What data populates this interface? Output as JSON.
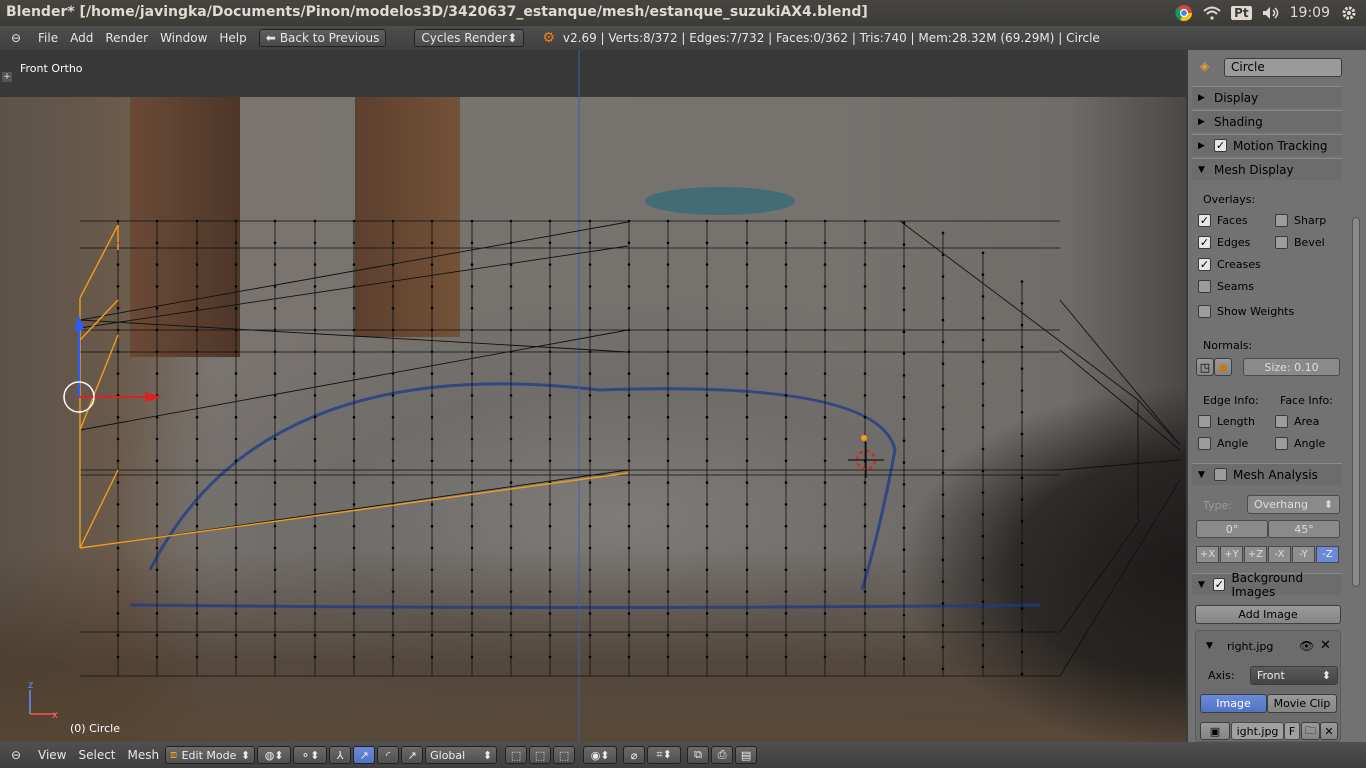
{
  "window": {
    "title": "Blender* [/home/javingka/Documents/Pinon/modelos3D/3420637_estanque/mesh/estanque_suzukiAX4.blend]"
  },
  "tray": {
    "input_method": "Pt",
    "time": "19:09"
  },
  "menu": {
    "file": "File",
    "add": "Add",
    "render": "Render",
    "window": "Window",
    "help": "Help",
    "back": "Back to Previous",
    "engine": "Cycles Render"
  },
  "stats": "v2.69 | Verts:8/372 | Edges:7/732 | Faces:0/362 | Tris:740 | Mem:28.32M (69.29M) | Circle",
  "viewport": {
    "view_name": "Front Ortho",
    "object_label": "(0) Circle",
    "axis_z": "z",
    "axis_x": "x"
  },
  "props": {
    "object_name": "Circle",
    "panels": {
      "display": "Display",
      "shading": "Shading",
      "motion_tracking": "Motion Tracking",
      "mesh_display": "Mesh Display",
      "mesh_analysis": "Mesh Analysis",
      "background_images": "Background Images"
    },
    "overlays_label": "Overlays:",
    "overlays": {
      "faces": "Faces",
      "sharp": "Sharp",
      "edges": "Edges",
      "bevel": "Bevel",
      "creases": "Creases",
      "seams": "Seams",
      "show_weights": "Show Weights"
    },
    "normals_label": "Normals:",
    "normals_size": "Size: 0.10",
    "edge_info_label": "Edge Info:",
    "face_info_label": "Face Info:",
    "edge_info": {
      "length": "Length",
      "angle": "Angle"
    },
    "face_info": {
      "area": "Area",
      "angle": "Angle"
    },
    "analysis_type_label": "Type:",
    "analysis_type": "Overhang",
    "angle_min": "0°",
    "angle_max": "45°",
    "axes": [
      "+X",
      "+Y",
      "+Z",
      "-X",
      "-Y",
      "-Z"
    ],
    "add_image": "Add Image",
    "bg_image_name": "right.jpg",
    "axis_label": "Axis:",
    "axis_value": "Front",
    "source_image": "Image",
    "source_movie": "Movie Clip",
    "file_field": "ight.jpg",
    "file_flag": "F"
  },
  "bottom": {
    "view": "View",
    "select": "Select",
    "mesh": "Mesh",
    "mode": "Edit Mode",
    "orientation": "Global"
  }
}
